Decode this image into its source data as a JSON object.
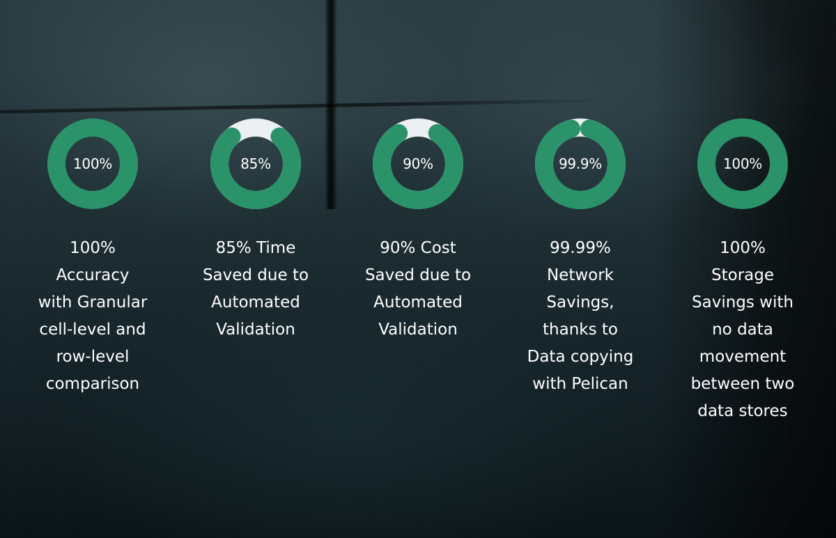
{
  "colors": {
    "ring_fill": "#2A936A",
    "ring_track": "#ECF0F2",
    "text": "#FFFFFF"
  },
  "chart_data": {
    "type": "donut",
    "title": "",
    "items": [
      {
        "label": "100%",
        "value": 100,
        "caption": "100%\nAccuracy\nwith Granular\ncell-level and\nrow-level\ncomparison"
      },
      {
        "label": "85%",
        "value": 85,
        "caption": "85% Time\nSaved due to\nAutomated\nValidation"
      },
      {
        "label": "90%",
        "value": 90,
        "caption": "90% Cost\nSaved due to\nAutomated\nValidation"
      },
      {
        "label": "99.9%",
        "value": 99.9,
        "caption": "99.99%\nNetwork\nSavings,\nthanks to\nData copying\nwith Pelican"
      },
      {
        "label": "100%",
        "value": 100,
        "caption": "100%\nStorage\nSavings with\nno data\nmovement\nbetween two\ndata stores"
      }
    ]
  }
}
